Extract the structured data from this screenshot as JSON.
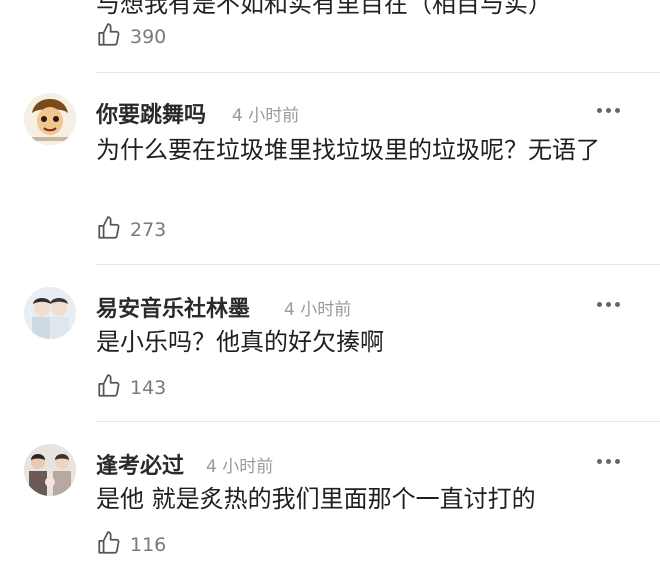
{
  "comments": [
    {
      "text": "与想我有是不如和实有里目在（相目与实）",
      "likes": "390"
    },
    {
      "username": "你要跳舞吗",
      "time": "4 小时前",
      "text": "为什么要在垃圾堆里找垃圾里的垃圾呢？无语了",
      "likes": "273"
    },
    {
      "username": "易安音乐社林墨",
      "time": "4 小时前",
      "text": "是小乐吗？他真的好欠揍啊",
      "likes": "143"
    },
    {
      "username": "逢考必过",
      "time": "4 小时前",
      "text": "是他 就是炙热的我们里面那个一直讨打的",
      "likes": "116"
    }
  ],
  "icons": {
    "like": "thumbs-up-icon",
    "more": "more-dots-icon"
  },
  "colors": {
    "username": "#2a2a2a",
    "timestamp": "#9a9a9a",
    "like_count": "#7a7a7a",
    "divider": "#e6e6e6"
  }
}
